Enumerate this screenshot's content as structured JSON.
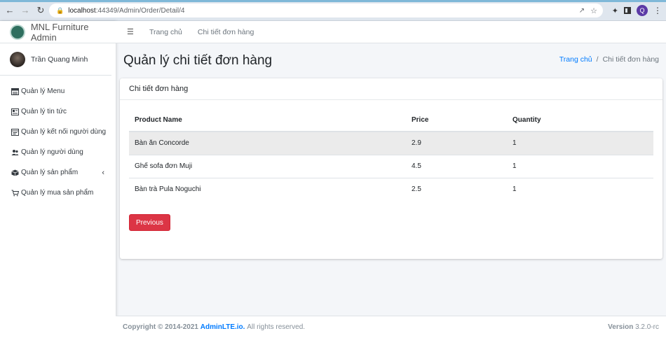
{
  "browser": {
    "url_host": "localhost",
    "url_path": ":44349/Admin/Order/Detail/4",
    "profile_initial": "Q"
  },
  "sidebar": {
    "brand": "MNL Furniture Admin",
    "user_name": "Trần Quang Minh",
    "items": [
      {
        "label": "Quản lý Menu",
        "icon": "menu-list-icon"
      },
      {
        "label": "Quản lý tin tức",
        "icon": "newspaper-icon"
      },
      {
        "label": "Quản lý kết nối người dùng",
        "icon": "window-icon"
      },
      {
        "label": "Quản lý người dùng",
        "icon": "users-icon"
      },
      {
        "label": "Quản lý sản phẩm",
        "icon": "box-icon"
      },
      {
        "label": "Quản lý mua sản phẩm",
        "icon": "cart-icon"
      }
    ]
  },
  "topnav": {
    "home": "Trang chủ",
    "detail": "Chi tiết đơn hàng"
  },
  "header": {
    "title": "Quản lý chi tiết đơn hàng",
    "breadcrumb_home": "Trang chủ",
    "breadcrumb_sep": "/",
    "breadcrumb_current": "Chi tiết đơn hàng"
  },
  "card": {
    "title": "Chi tiết đơn hàng",
    "columns": [
      "Product Name",
      "Price",
      "Quantity"
    ],
    "rows": [
      [
        "Bàn ăn Concorde",
        "2.9",
        "1"
      ],
      [
        "Ghế sofa đơn Muji",
        "4.5",
        "1"
      ],
      [
        "Bàn trà Pula Noguchi",
        "2.5",
        "1"
      ]
    ],
    "previous_label": "Previous"
  },
  "footer": {
    "copyright_prefix": "Copyright © 2014-2021",
    "link": "AdminLTE.io.",
    "suffix": "All rights reserved.",
    "version_label": "Version",
    "version_value": "3.2.0-rc"
  },
  "colors": {
    "accent": "#007bff",
    "danger": "#dc3545"
  }
}
